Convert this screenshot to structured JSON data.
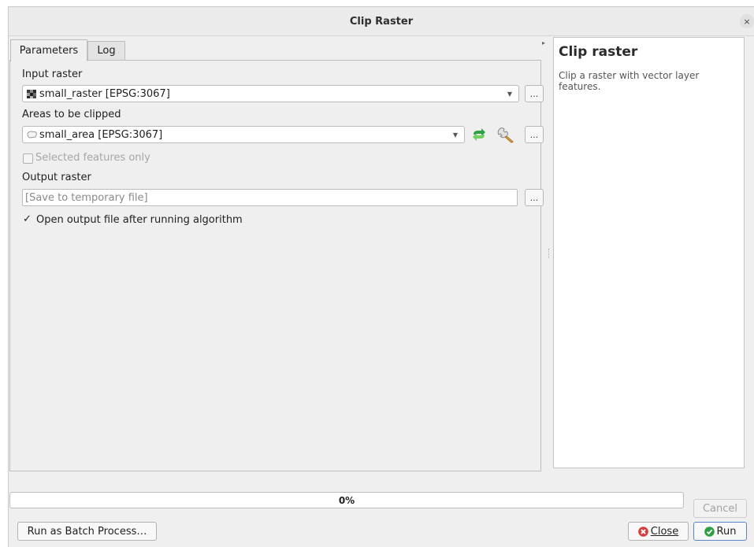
{
  "window": {
    "title": "Clip Raster",
    "close_glyph": "×"
  },
  "tabs": [
    {
      "label": "Parameters"
    },
    {
      "label": "Log"
    }
  ],
  "params": {
    "input_raster_label": "Input raster",
    "input_raster_value": "small_raster [EPSG:3067]",
    "areas_label": "Areas to be clipped",
    "areas_value": "small_area [EPSG:3067]",
    "selected_only_label": "Selected features only",
    "selected_only_checked": false,
    "output_label": "Output raster",
    "output_placeholder": "[Save to temporary file]",
    "open_output_label": "Open output file after running algorithm",
    "open_output_checked": true,
    "browse_label": "..."
  },
  "help": {
    "title": "Clip raster",
    "body": "Clip a raster with vector layer features."
  },
  "progress": {
    "value_text": "0%",
    "fraction": 0
  },
  "buttons": {
    "cancel": "Cancel",
    "batch": "Run as Batch Process…",
    "close": "Close",
    "run": "Run"
  },
  "colors": {
    "accent_green": "#2ea043",
    "close_red": "#d93b3b",
    "run_border": "#5b86c8"
  },
  "icons": [
    "raster-layer-icon",
    "polygon-layer-icon",
    "iterate-icon",
    "wrench-icon",
    "close-icon",
    "run-icon",
    "dropdown-arrow-icon"
  ]
}
